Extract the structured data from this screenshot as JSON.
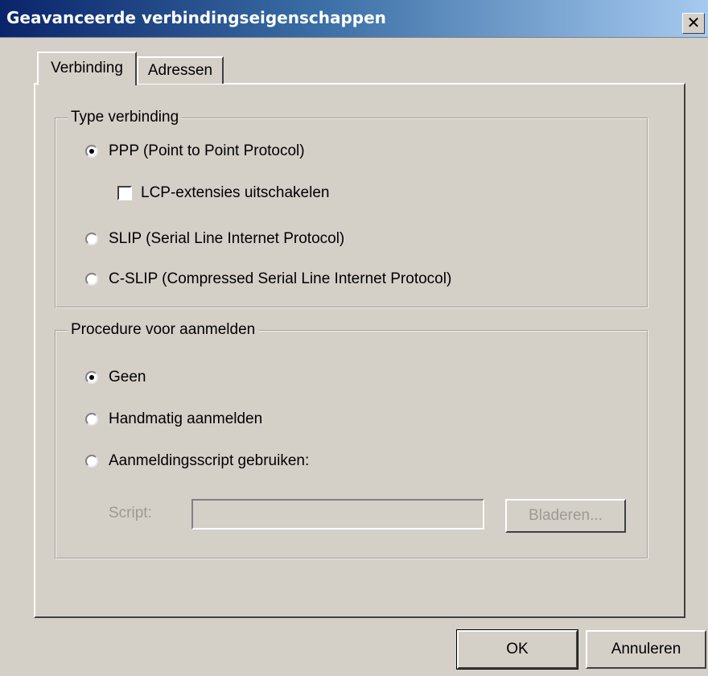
{
  "window": {
    "title": "Geavanceerde verbindingseigenschappen",
    "close_glyph": "✕"
  },
  "tabs": [
    {
      "label": "Verbinding",
      "selected": true
    },
    {
      "label": "Adressen",
      "selected": false
    }
  ],
  "connection_type": {
    "legend": "Type verbinding",
    "options": [
      {
        "label": "PPP (Point to Point Protocol)",
        "selected": true
      },
      {
        "label": "SLIP (Serial Line Internet Protocol)",
        "selected": false
      },
      {
        "label": "C-SLIP (Compressed Serial Line Internet Protocol)",
        "selected": false
      }
    ],
    "lcp_checkbox": {
      "label": "LCP-extensies uitschakelen",
      "checked": false
    }
  },
  "logon": {
    "legend": "Procedure voor aanmelden",
    "options": [
      {
        "label": "Geen",
        "selected": true
      },
      {
        "label": "Handmatig aanmelden",
        "selected": false
      },
      {
        "label": "Aanmeldingsscript gebruiken:",
        "selected": false
      }
    ],
    "script_label": "Script:",
    "script_value": "",
    "browse_label": "Bladeren..."
  },
  "buttons": {
    "ok": "OK",
    "cancel": "Annuleren"
  }
}
